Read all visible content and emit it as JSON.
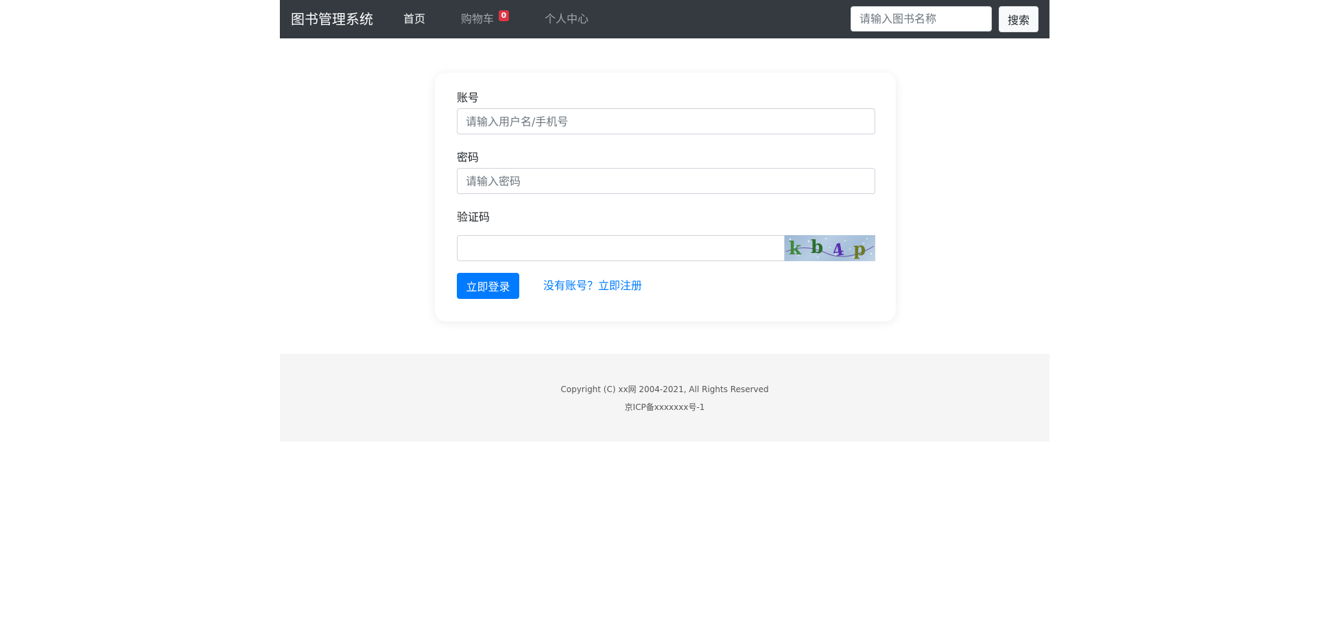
{
  "navbar": {
    "brand": "图书管理系统",
    "links": [
      {
        "label": "首页",
        "active": true
      },
      {
        "label": "购物车",
        "badge": "0"
      },
      {
        "label": "个人中心"
      }
    ],
    "search": {
      "placeholder": "请输入图书名称",
      "value": "",
      "button_label": "搜索"
    }
  },
  "login_form": {
    "account": {
      "label": "账号",
      "placeholder": "请输入用户名/手机号",
      "value": ""
    },
    "password": {
      "label": "密码",
      "placeholder": "请输入密码",
      "value": ""
    },
    "captcha": {
      "label": "验证码",
      "value": "",
      "image_text": "kb4p"
    },
    "submit_label": "立即登录",
    "register_link": "没有账号？立即注册"
  },
  "footer": {
    "copyright": "Copyright (C) xx网 2004-2021, All Rights Reserved",
    "icp": "京ICP备xxxxxxx号-1"
  },
  "colors": {
    "navbar_bg": "#343a40",
    "primary": "#007bff",
    "badge": "#dc3545",
    "footer_bg": "#f5f5f5"
  }
}
